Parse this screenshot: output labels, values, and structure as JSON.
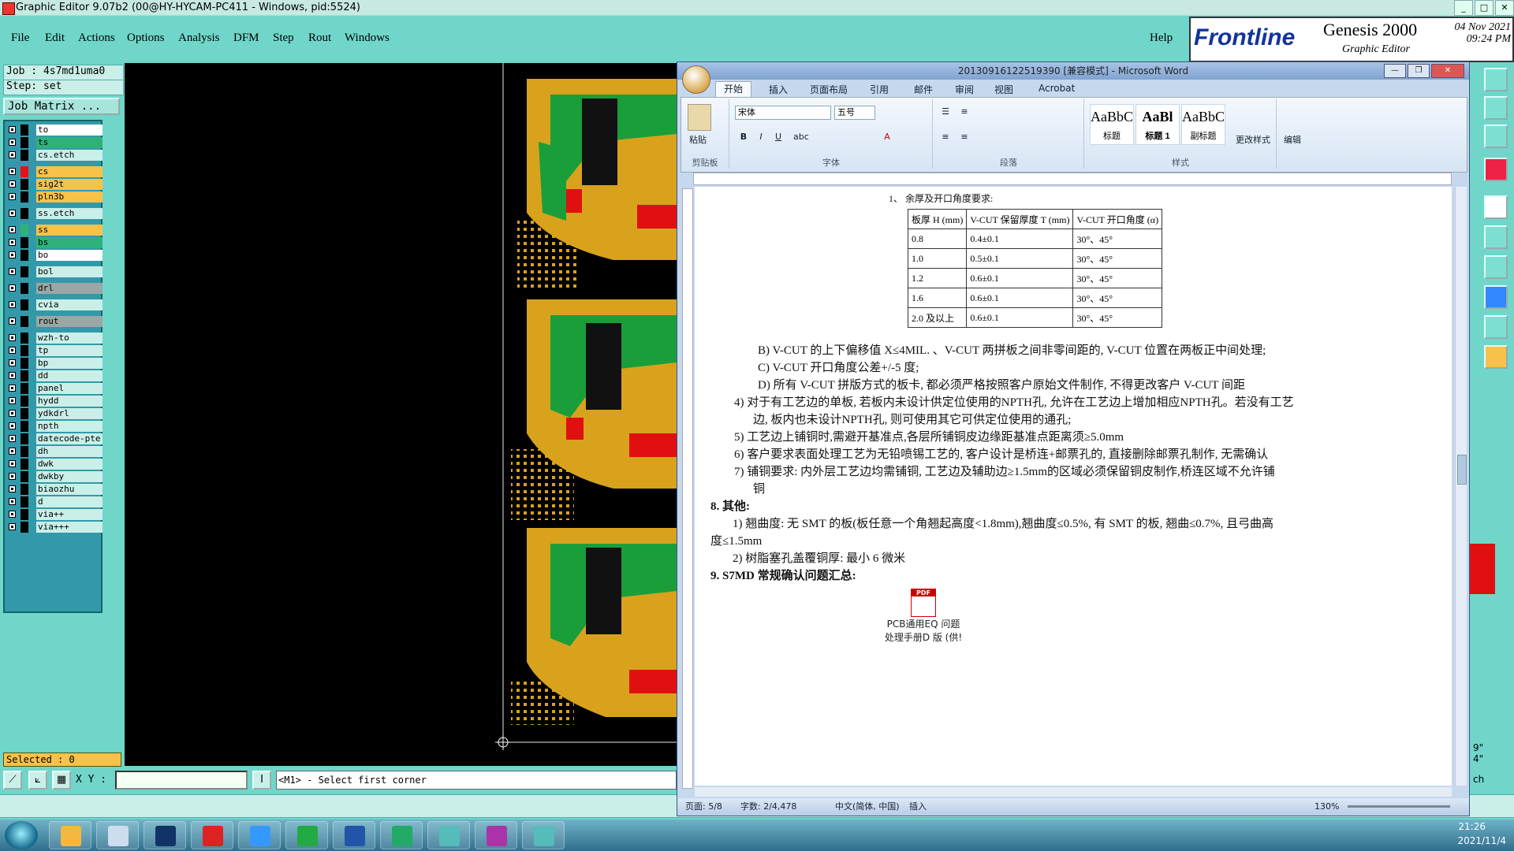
{
  "genesis": {
    "window_title": "Graphic Editor 9.07b2 (00@HY-HYCAM-PC411 - Windows, pid:5524)",
    "menus": [
      "File",
      "Edit",
      "Actions",
      "Options",
      "Analysis",
      "DFM",
      "Step",
      "Rout",
      "Windows"
    ],
    "help": "Help",
    "logo": {
      "brand": "Frontline",
      "product": "Genesis 2000",
      "subtitle": "Graphic Editor",
      "date": "04 Nov 2021",
      "time": "09:24 PM"
    },
    "job": "Job : 4s7md1uma0",
    "step": "Step: set",
    "job_matrix": "Job Matrix ...",
    "layers": [
      {
        "name": "to",
        "swatch": "#000000",
        "bg": "#ffffff"
      },
      {
        "name": "ts",
        "swatch": "#000000",
        "bg": "#2fb27a"
      },
      {
        "name": "cs.etch",
        "swatch": "#000000",
        "bg": "#c9efe8"
      },
      {
        "name": "cs",
        "swatch": "#e8101a",
        "bg": "#f7c24a"
      },
      {
        "name": "sig2t",
        "swatch": "#000000",
        "bg": "#f7c24a"
      },
      {
        "name": "pln3b",
        "swatch": "#000000",
        "bg": "#f7c24a"
      },
      {
        "name": "ss.etch",
        "swatch": "#000000",
        "bg": "#c9efe8"
      },
      {
        "name": "ss",
        "swatch": "#2fb27a",
        "bg": "#f7c24a"
      },
      {
        "name": "bs",
        "swatch": "#000000",
        "bg": "#2fb27a"
      },
      {
        "name": "bo",
        "swatch": "#000000",
        "bg": "#ffffff"
      },
      {
        "name": "bol",
        "swatch": "#000000",
        "bg": "#c9efe8"
      },
      {
        "name": "drl",
        "swatch": "#000000",
        "bg": "#9aa7a6"
      },
      {
        "name": "cvia",
        "swatch": "#000000",
        "bg": "#c9efe8"
      },
      {
        "name": "rout",
        "swatch": "#000000",
        "bg": "#9aa7a6"
      },
      {
        "name": "wzh-to",
        "swatch": "#000000",
        "bg": "#c9efe8"
      },
      {
        "name": "tp",
        "swatch": "#000000",
        "bg": "#c9efe8"
      },
      {
        "name": "bp",
        "swatch": "#000000",
        "bg": "#c9efe8"
      },
      {
        "name": "dd",
        "swatch": "#000000",
        "bg": "#c9efe8"
      },
      {
        "name": "panel",
        "swatch": "#000000",
        "bg": "#c9efe8"
      },
      {
        "name": "hydd",
        "swatch": "#000000",
        "bg": "#c9efe8"
      },
      {
        "name": "ydkdrl",
        "swatch": "#000000",
        "bg": "#c9efe8"
      },
      {
        "name": "npth",
        "swatch": "#000000",
        "bg": "#c9efe8"
      },
      {
        "name": "datecode-pte",
        "swatch": "#000000",
        "bg": "#c9efe8"
      },
      {
        "name": "dh",
        "swatch": "#000000",
        "bg": "#c9efe8"
      },
      {
        "name": "dwk",
        "swatch": "#000000",
        "bg": "#c9efe8"
      },
      {
        "name": "dwkby",
        "swatch": "#000000",
        "bg": "#c9efe8"
      },
      {
        "name": "biaozhu",
        "swatch": "#000000",
        "bg": "#c9efe8"
      },
      {
        "name": "d",
        "swatch": "#000000",
        "bg": "#c9efe8"
      },
      {
        "name": "via++",
        "swatch": "#000000",
        "bg": "#c9efe8"
      },
      {
        "name": "via+++",
        "swatch": "#000000",
        "bg": "#c9efe8"
      }
    ],
    "selected": "Selected : 0",
    "xy_label": "X Y :",
    "prompt": "<M1> - Select first corner",
    "right_side_text": [
      "9\"",
      "4\"",
      "ch"
    ]
  },
  "word": {
    "title": "20130916122519390 [兼容模式] - Microsoft Word",
    "tabs": [
      "开始",
      "插入",
      "页面布局",
      "引用",
      "邮件",
      "审阅",
      "视图",
      "Acrobat"
    ],
    "ribbon": {
      "paste": "粘贴",
      "clipboard": "剪贴板",
      "font_name": "宋体",
      "font_size": "五号",
      "font_group": "字体",
      "paragraph_group": "段落",
      "styles_group": "样式",
      "styles": [
        {
          "preview": "AaBbC",
          "name": "标题"
        },
        {
          "preview": "AaBl",
          "name": "标题 1"
        },
        {
          "preview": "AaBbC",
          "name": "副标题"
        }
      ],
      "change_styles": "更改样式",
      "edit": "编辑"
    },
    "table_caption": "1、 余厚及开口角度要求:",
    "table_header": [
      "板厚 H (mm)",
      "V-CUT 保留厚度 T (mm)",
      "V-CUT 开口角度 (α)"
    ],
    "table_rows": [
      [
        "0.8",
        "0.4±0.1",
        "30°、45°"
      ],
      [
        "1.0",
        "0.5±0.1",
        "30°、45°"
      ],
      [
        "1.2",
        "0.6±0.1",
        "30°、45°"
      ],
      [
        "1.6",
        "0.6±0.1",
        "30°、45°"
      ],
      [
        "2.0 及以上",
        "0.6±0.1",
        "30°、45°"
      ]
    ],
    "lines": [
      "B) V-CUT 的上下偏移值 X≤4MIL. 、V-CUT 两拼板之间非零间距的, V-CUT 位置在两板正中间处理;",
      "C) V-CUT 开口角度公差+/-5 度;",
      "D) 所有 V-CUT 拼版方式的板卡, 都必须严格按照客户原始文件制作, 不得更改客户 V-CUT 间距",
      "4) 对于有工艺边的单板, 若板内未设计供定位使用的NPTH孔, 允许在工艺边上增加相应NPTH孔。若没有工艺",
      "边, 板内也未设计NPTH孔, 则可使用其它可供定位使用的通孔;",
      "5) 工艺边上铺铜时,需避开基准点,各层所铺铜皮边缘距基准点距离须≥5.0mm",
      "6) 客户要求表面处理工艺为无铅喷锡工艺的, 客户设计是桥连+邮票孔的, 直接删除邮票孔制作, 无需确认",
      "7) 铺铜要求: 内外层工艺边均需铺铜, 工艺边及辅助边≥1.5mm的区域必须保留铜皮制作,桥连区域不允许铺",
      "铜",
      "8. 其他:",
      "1) 翘曲度: 无 SMT 的板(板任意一个角翘起高度<1.8mm),翘曲度≤0.5%, 有 SMT 的板, 翘曲≤0.7%, 且弓曲高",
      "度≤1.5mm",
      "2) 树脂塞孔盖覆铜厚: 最小 6 微米",
      "9. S7MD 常规确认问题汇总:"
    ],
    "attachment": [
      "PCB通用EQ 问题",
      "处理手册D 版 (供!"
    ],
    "status": {
      "page": "页面: 5/8",
      "words": "字数: 2/4,478",
      "lang": "中文(简体, 中国)",
      "mode": "插入",
      "zoom": "130%"
    }
  },
  "taskbar": {
    "time": "21:26",
    "date": "2021/11/4"
  }
}
